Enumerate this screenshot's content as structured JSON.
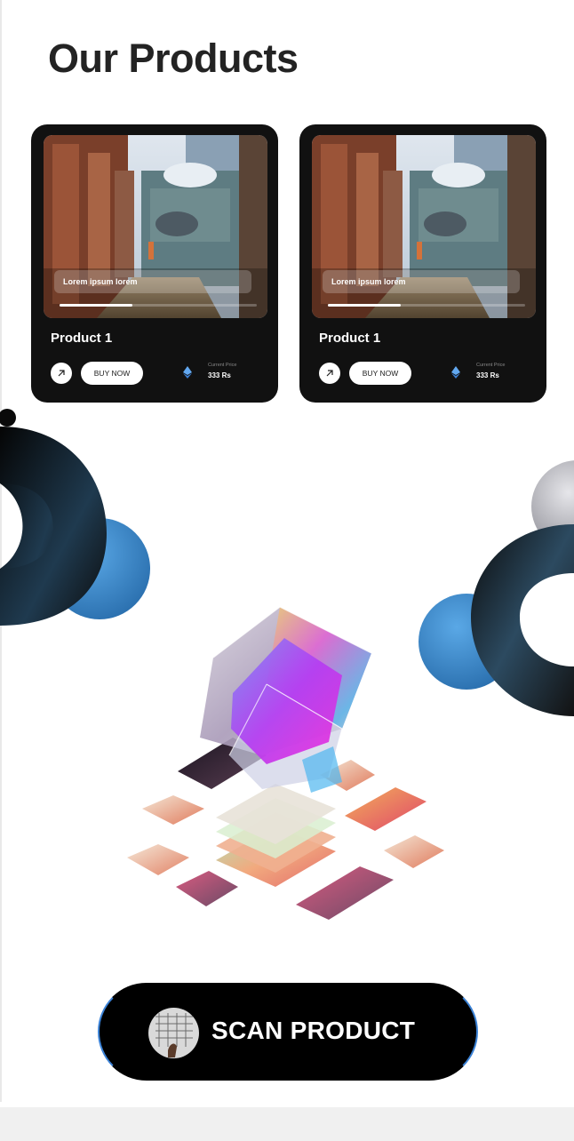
{
  "page": {
    "title": "Our Products"
  },
  "products": [
    {
      "overlay_text": "Lorem ipsum lorem",
      "name": "Product 1",
      "buy_label": "BUY NOW",
      "price_label": "Current Price",
      "price_value": "333 Rs",
      "progress": 0.37,
      "currency_icon": "ethereum-icon",
      "open_icon": "arrow-up-right-icon"
    },
    {
      "overlay_text": "Lorem ipsum lorem",
      "name": "Product 1",
      "buy_label": "BUY NOW",
      "price_label": "Current Price",
      "price_value": "333 Rs",
      "progress": 0.37,
      "currency_icon": "ethereum-icon",
      "open_icon": "arrow-up-right-icon"
    }
  ],
  "scan": {
    "label": "SCAN PRODUCT",
    "icon": "scan-thumbnail"
  },
  "colors": {
    "card_bg": "#111111",
    "accent_blue": "#3b8ed0",
    "scan_border": "#3b82d6"
  }
}
